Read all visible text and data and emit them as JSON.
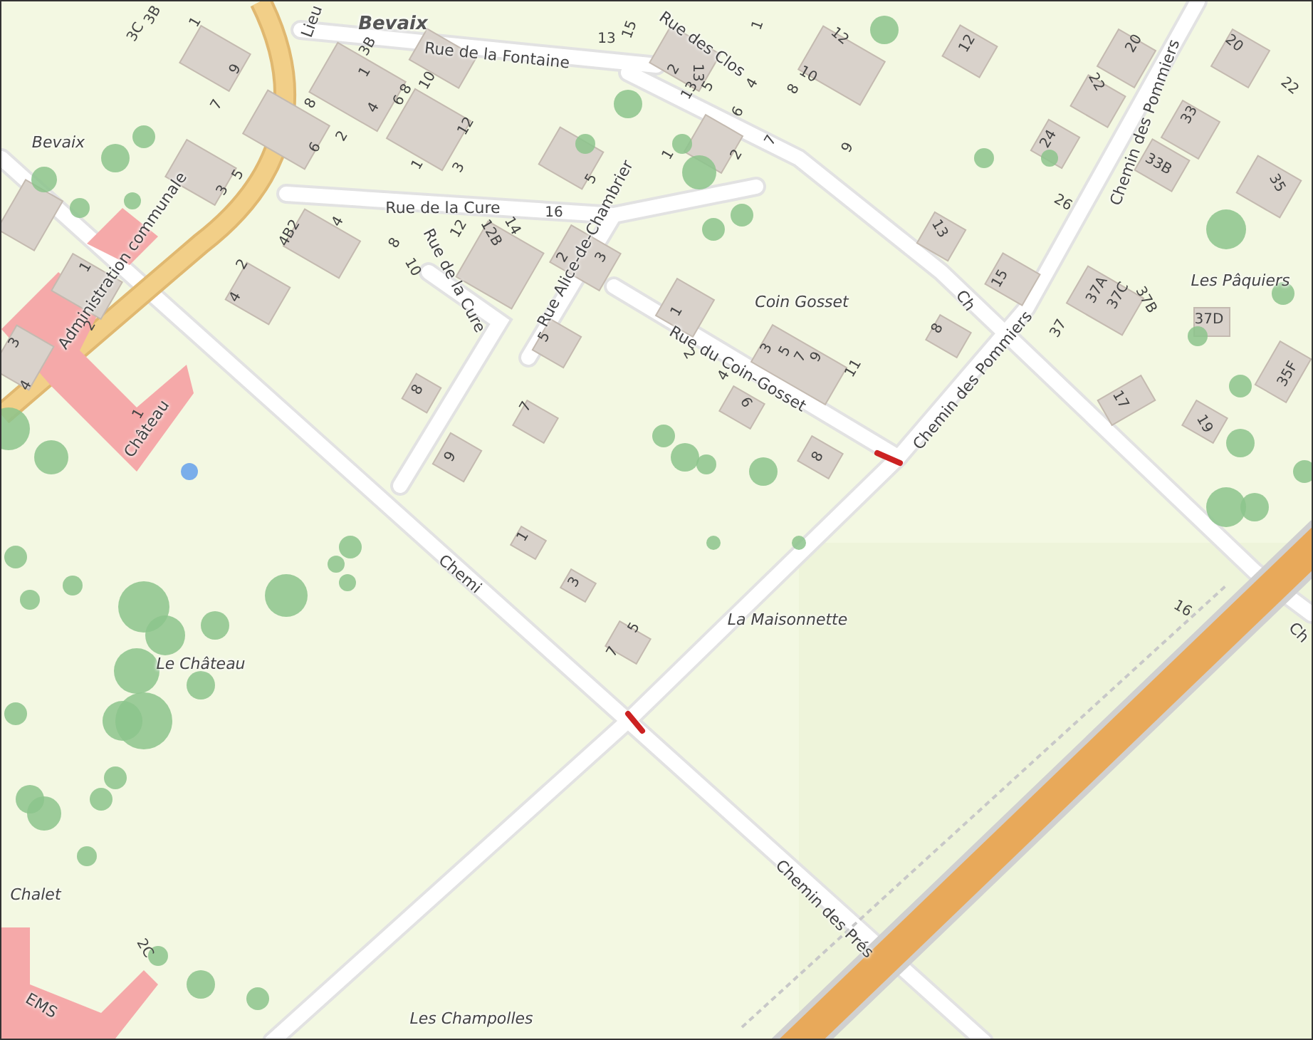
{
  "map": {
    "labels": [
      {
        "text": "Bevaix",
        "kind": "town"
      },
      {
        "text": "Lieu",
        "kind": "street"
      },
      {
        "text": "Rue de la Fontaine",
        "kind": "street"
      },
      {
        "text": "Rue des Clos",
        "kind": "street"
      },
      {
        "text": "Bevaix",
        "kind": "place"
      },
      {
        "text": "Administration communale",
        "kind": "street"
      },
      {
        "text": "Château",
        "kind": "street"
      },
      {
        "text": "Rue de la Cure",
        "kind": "street"
      },
      {
        "text": "Rue de la Cure",
        "kind": "street"
      },
      {
        "text": "Rue Alice-de-Chambrier",
        "kind": "street"
      },
      {
        "text": "Coin Gosset",
        "kind": "place"
      },
      {
        "text": "Rue du Coin-Gosset",
        "kind": "street"
      },
      {
        "text": "Ch",
        "kind": "street"
      },
      {
        "text": "Chemin des Pommiers",
        "kind": "street"
      },
      {
        "text": "Chemin des Pommiers",
        "kind": "street"
      },
      {
        "text": "Les Pâquiers",
        "kind": "place"
      },
      {
        "text": "La Maisonnette",
        "kind": "place"
      },
      {
        "text": "Le Château",
        "kind": "place"
      },
      {
        "text": "Chemi",
        "kind": "street"
      },
      {
        "text": "Chemin des Prés",
        "kind": "street"
      },
      {
        "text": "Chalet",
        "kind": "place"
      },
      {
        "text": "EMS",
        "kind": "street"
      },
      {
        "text": "Ch",
        "kind": "street"
      },
      {
        "text": "Les Champolles",
        "kind": "place"
      }
    ],
    "house_numbers": [
      "3C",
      "3B",
      "1",
      "9",
      "7",
      "3",
      "5",
      "8",
      "1",
      "3B",
      "10",
      "8",
      "6",
      "4",
      "12",
      "6",
      "2",
      "1",
      "3",
      "5",
      "4B2",
      "4",
      "8",
      "10",
      "12",
      "12B",
      "14",
      "16",
      "2",
      "3",
      "2",
      "4",
      "1",
      "2",
      "3",
      "4",
      "1",
      "8",
      "7",
      "9",
      "5",
      "13",
      "15",
      "1",
      "12",
      "12",
      "20",
      "20",
      "22",
      "22",
      "33",
      "24",
      "33B",
      "35",
      "26",
      "13",
      "15",
      "37",
      "37A",
      "37C",
      "37B",
      "37D",
      "35F",
      "17",
      "19",
      "10",
      "8",
      "7",
      "9",
      "2",
      "1",
      "4",
      "2",
      "13",
      "13",
      "5",
      "6",
      "1",
      "2",
      "4",
      "3",
      "5",
      "7",
      "9",
      "11",
      "6",
      "8",
      "8",
      "1",
      "3",
      "7",
      "5",
      "2C",
      "16"
    ]
  }
}
